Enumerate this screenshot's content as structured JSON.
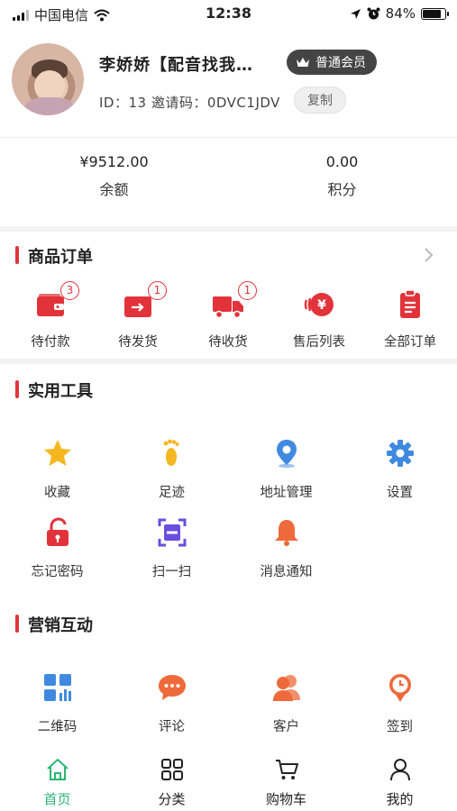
{
  "status_bar": {
    "carrier": "中国电信",
    "time": "12:38",
    "battery": "84%",
    "battery_level": 0.84
  },
  "profile": {
    "nickname": "李娇娇【配音找我…",
    "member_level": "普通会员",
    "id_line": "ID：13  邀请码：0DVC1JDV",
    "copy_label": "复制"
  },
  "wallet": [
    {
      "value": "¥9512.00",
      "label": "余额"
    },
    {
      "value": "0.00",
      "label": "积分"
    }
  ],
  "orders": {
    "title": "商品订单",
    "items": [
      {
        "label": "待付款",
        "badge": "3",
        "icon": "wallet-icon"
      },
      {
        "label": "待发货",
        "badge": "1",
        "icon": "package-icon"
      },
      {
        "label": "待收货",
        "badge": "1",
        "icon": "truck-icon"
      },
      {
        "label": "售后列表",
        "badge": "",
        "icon": "refund-icon"
      },
      {
        "label": "全部订单",
        "badge": "",
        "icon": "clipboard-icon"
      }
    ]
  },
  "tools": {
    "title": "实用工具",
    "items": [
      {
        "label": "收藏",
        "icon": "star-icon"
      },
      {
        "label": "足迹",
        "icon": "footprint-icon"
      },
      {
        "label": "地址管理",
        "icon": "location-icon"
      },
      {
        "label": "设置",
        "icon": "gear-icon"
      },
      {
        "label": "忘记密码",
        "icon": "unlock-icon"
      },
      {
        "label": "扫一扫",
        "icon": "scan-icon"
      },
      {
        "label": "消息通知",
        "icon": "bell-icon"
      }
    ]
  },
  "marketing": {
    "title": "营销互动",
    "items": [
      {
        "label": "二维码",
        "icon": "qrcode-icon"
      },
      {
        "label": "评论",
        "icon": "comment-icon"
      },
      {
        "label": "客户",
        "icon": "customer-icon"
      },
      {
        "label": "签到",
        "icon": "checkin-icon"
      }
    ]
  },
  "tabbar": {
    "items": [
      {
        "label": "首页",
        "icon": "home-icon",
        "active": true
      },
      {
        "label": "分类",
        "icon": "category-icon",
        "active": false
      },
      {
        "label": "购物车",
        "icon": "cart-icon",
        "active": false
      },
      {
        "label": "我的",
        "icon": "user-icon",
        "active": false
      }
    ]
  },
  "colors": {
    "accent_red": "#e2333b",
    "active_green": "#2bb673",
    "star_yellow": "#f5b720",
    "blue": "#3f8ae0",
    "orange": "#ee6a3a"
  }
}
